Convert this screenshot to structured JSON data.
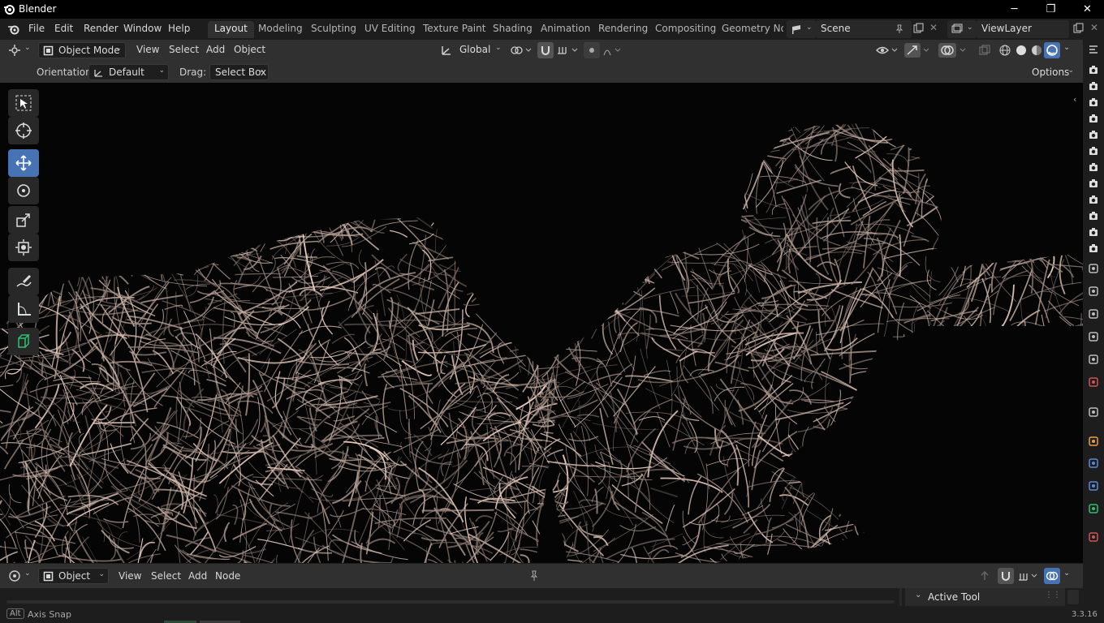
{
  "window": {
    "title": "Blender"
  },
  "menu": [
    "File",
    "Edit",
    "Render",
    "Window",
    "Help"
  ],
  "workspaces": [
    "Layout",
    "Modeling",
    "Sculpting",
    "UV Editing",
    "Texture Paint",
    "Shading",
    "Animation",
    "Rendering",
    "Compositing",
    "Geometry Noc"
  ],
  "active_workspace": "Layout",
  "scene": {
    "name": "Scene"
  },
  "view_layer": {
    "name": "ViewLayer"
  },
  "viewport_header": {
    "mode": "Object Mode",
    "menus": [
      "View",
      "Select",
      "Add",
      "Object"
    ],
    "transform_orientation": "Global"
  },
  "tool_settings": {
    "orientation_label": "Orientation:",
    "orientation_value": "Default",
    "drag_label": "Drag:",
    "drag_value": "Select Box",
    "options_label": "Options"
  },
  "toolbar": [
    "select-box",
    "cursor",
    "move",
    "rotate",
    "scale",
    "transform",
    "annotate",
    "measure",
    "add-cube"
  ],
  "active_tool_index": 2,
  "bottom_editor": {
    "mode": "Object",
    "menus": [
      "View",
      "Select",
      "Add",
      "Node"
    ],
    "panel_title": "Active Tool"
  },
  "status": {
    "key": "Alt",
    "hint": "Axis Snap",
    "version": "3.3.16"
  },
  "colors": {
    "accent": "#4772b3",
    "viewport_bg": "#050505",
    "wire": "#b8a49c"
  }
}
